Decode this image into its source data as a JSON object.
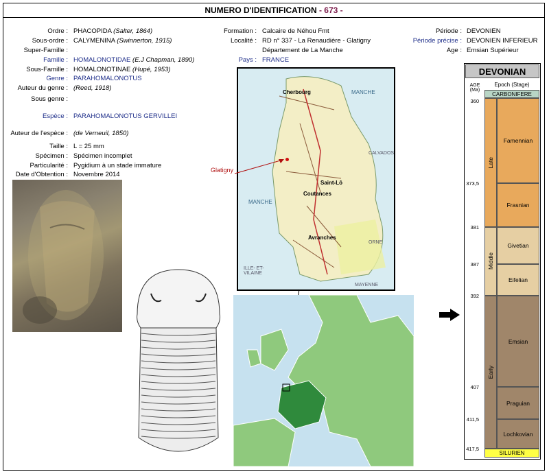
{
  "title": {
    "prefix": "NUMERO D'IDENTIFICATION",
    "number": "- 673 -"
  },
  "taxonomy": [
    {
      "label": "Ordre",
      "value": "PHACOPIDA",
      "author": "(Salter, 1864)",
      "blue": false
    },
    {
      "label": "Sous-ordre",
      "value": "CALYMENINA",
      "author": "(Swinnerton, 1915)",
      "blue": false
    },
    {
      "label": "Super-Famille",
      "value": "",
      "author": "",
      "blue": false
    },
    {
      "label": "Famille",
      "value": "HOMALONOTIDAE",
      "author": "(E.J Chapman, 1890)",
      "blue": true
    },
    {
      "label": "Sous-Famille",
      "value": "HOMALONOTINAE",
      "author": "(Hupé, 1953)",
      "blue": false
    },
    {
      "label": "Genre",
      "value": "PARAHOMALONOTUS",
      "author": "",
      "blue": true
    },
    {
      "label": "Auteur du genre",
      "value": "",
      "author": "(Reed, 1918)",
      "blue": false
    },
    {
      "label": "Sous genre",
      "value": "",
      "author": "",
      "blue": false
    }
  ],
  "species": {
    "label": "Espèce",
    "value": "PARAHOMALONOTUS GERVILLEI"
  },
  "details": [
    {
      "label": "Auteur de l'espèce",
      "value": "(de Verneuil, 1850)"
    },
    {
      "label": "Taille",
      "value": "L = 25 mm"
    },
    {
      "label": "Spécimen",
      "value": "Spécimen incomplet"
    },
    {
      "label": "Particularité",
      "value": "Pygidium à un stade immature"
    },
    {
      "label": "Date d'Obtention",
      "value": "Novembre 2014"
    }
  ],
  "location": {
    "formation_label": "Formation",
    "formation": "Calcaire de Néhou Fmt",
    "localite_label": "Localité",
    "localite": "RD n° 337 - La Renaudière - Glatigny",
    "departement": "Département de La Manche",
    "pays_label": "Pays",
    "pays": "FRANCE"
  },
  "period": {
    "periode_label": "Période",
    "periode": "DEVONIEN",
    "precise_label": "Période précise",
    "precise": "DEVONIEN INFERIEUR",
    "age_label": "Age",
    "age": "Emsian Supérieur"
  },
  "map_labels": {
    "glatigny": "Glatigny",
    "manche_top": "MANCHE",
    "manche_sea": "MANCHE",
    "calvados": "CALVADOS",
    "orne": "ORNE",
    "ille": "ILLE- ET- VILAINE",
    "mayenne": "MAYENNE",
    "cherbourg": "Cherbourg",
    "saintlo": "Saint-Lô",
    "coutances": "Coutances",
    "avranches": "Avranches"
  },
  "geo": {
    "header": "DEVONIAN",
    "age_head": "AGE (Ma)",
    "epoch_head": "Epoch (Stage)",
    "top": "CARBONIFERE",
    "bottom": "SILURIEN",
    "epochs": [
      "Late",
      "Middle",
      "Early"
    ],
    "stages": [
      "Famennian",
      "Frasnian",
      "Givetian",
      "Eifelian",
      "Emsian",
      "Praguian",
      "Lochkovian"
    ],
    "ages": [
      "360",
      "373,5",
      "381",
      "387",
      "392",
      "407",
      "411,5",
      "417,5"
    ]
  },
  "colors": {
    "late": "#e8a95c",
    "middle": "#e6cfa3",
    "early": "#a0866a",
    "top": "#b9d6c6",
    "bottom": "#ffff44"
  }
}
